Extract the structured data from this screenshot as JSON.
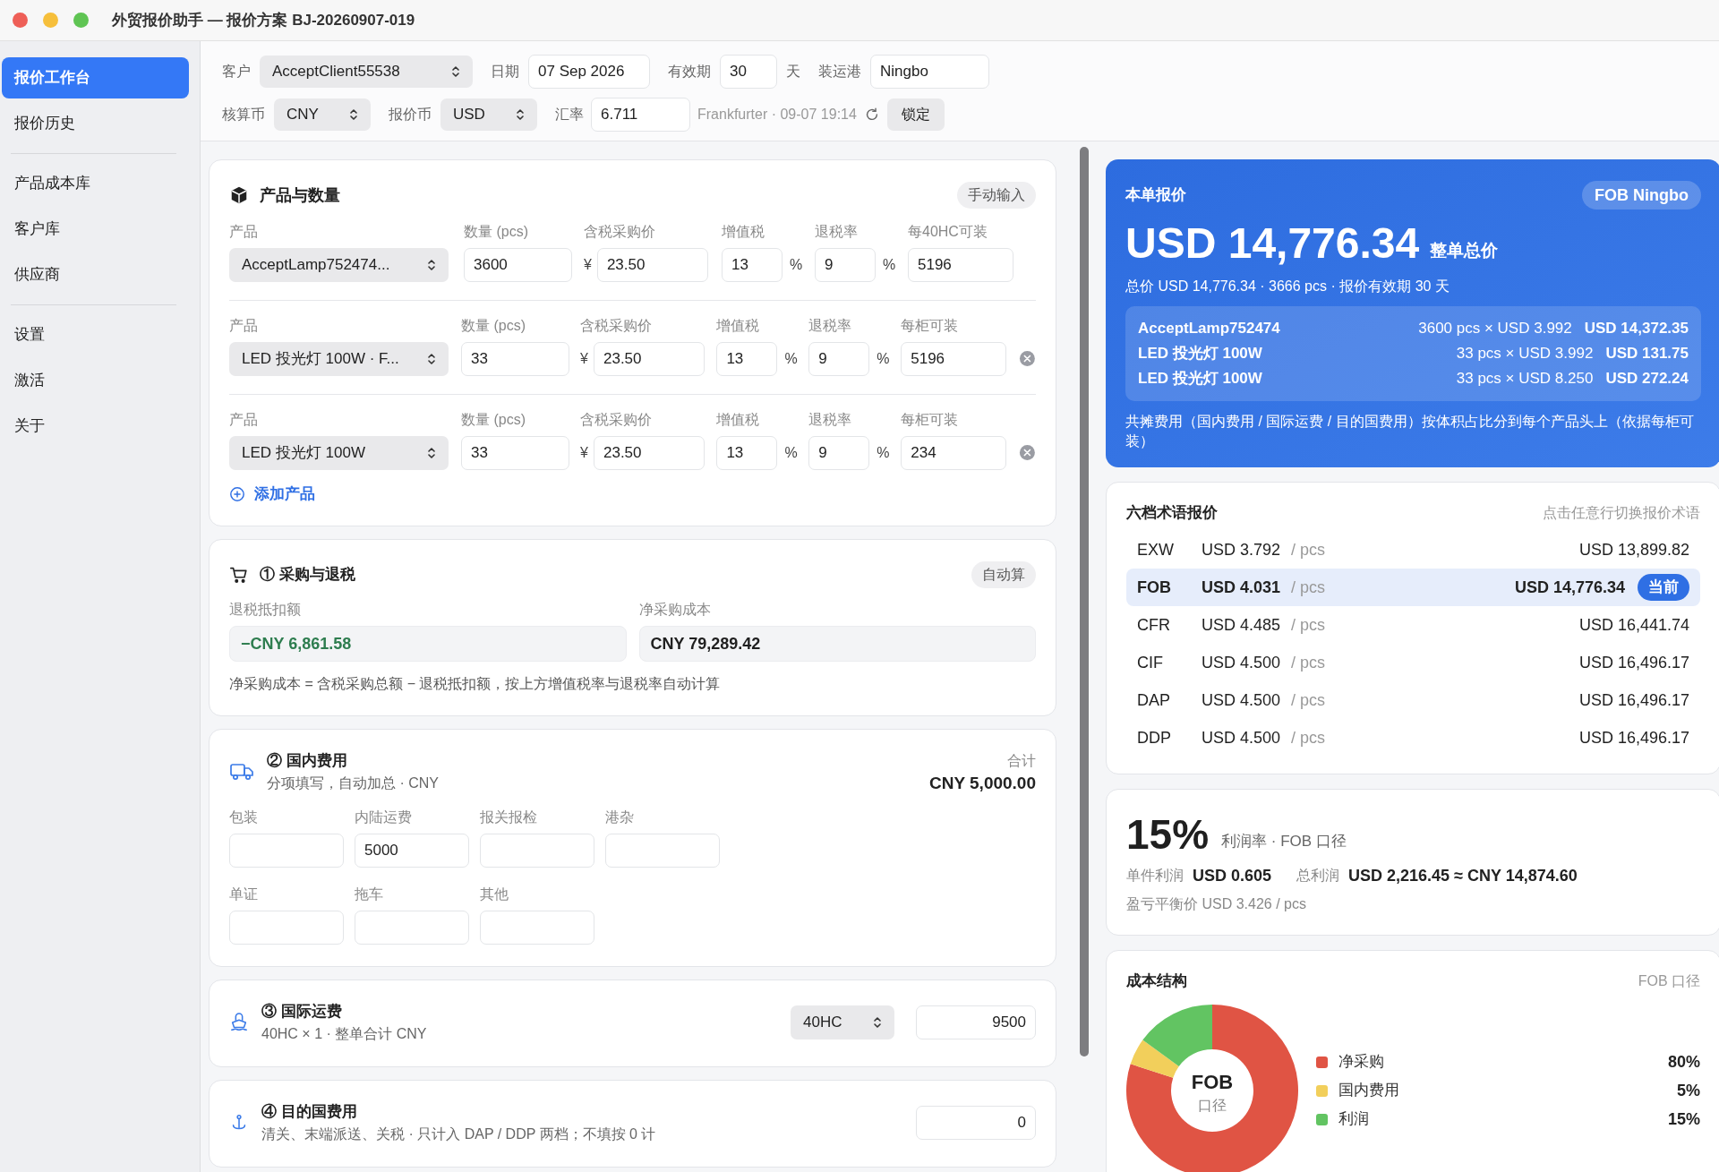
{
  "window": {
    "title": "外贸报价助手 — 报价方案 BJ-20260907-019"
  },
  "sidebar": {
    "groups": [
      {
        "items": [
          {
            "label": "报价工作台",
            "selected": true
          },
          {
            "label": "报价历史",
            "selected": false
          }
        ]
      },
      {
        "items": [
          {
            "label": "产品成本库",
            "selected": false
          },
          {
            "label": "客户库",
            "selected": false
          },
          {
            "label": "供应商",
            "selected": false
          }
        ]
      },
      {
        "items": [
          {
            "label": "设置",
            "selected": false
          },
          {
            "label": "激活",
            "selected": false
          },
          {
            "label": "关于",
            "selected": false
          }
        ]
      }
    ]
  },
  "toolbar": {
    "client": {
      "label": "客户",
      "value": "AcceptClient55538"
    },
    "date": {
      "label": "日期",
      "value": "07 Sep 2026"
    },
    "validity": {
      "label": "有效期",
      "value": "30",
      "unit": "天"
    },
    "port": {
      "label": "装运港",
      "value": "Ningbo"
    },
    "cost_currency": {
      "label": "核算币",
      "value": "CNY"
    },
    "quote_currency": {
      "label": "报价币",
      "value": "USD"
    },
    "rate": {
      "label": "汇率",
      "value": "6.711",
      "source": "Frankfurter · 09-07 19:14"
    },
    "lock_button": "锁定"
  },
  "products": {
    "title": "产品与数量",
    "badge": "手动输入",
    "add_button": "添加产品",
    "rows": [
      {
        "labels": [
          "产品",
          "数量 (pcs)",
          "含税采购价",
          "增值税",
          "退税率",
          "每40HC可装"
        ],
        "product": "AcceptLamp752474...",
        "qty": "3600",
        "currency": "¥",
        "price": "23.50",
        "vat": "13",
        "vat_unit": "%",
        "refund": "9",
        "refund_unit": "%",
        "capacity": "5196",
        "removable": false
      },
      {
        "labels": [
          "产品",
          "数量 (pcs)",
          "含税采购价",
          "增值税",
          "退税率",
          "每柜可装"
        ],
        "product": "LED 投光灯 100W · F...",
        "qty": "33",
        "currency": "¥",
        "price": "23.50",
        "vat": "13",
        "vat_unit": "%",
        "refund": "9",
        "refund_unit": "%",
        "capacity": "5196",
        "removable": true
      },
      {
        "labels": [
          "产品",
          "数量 (pcs)",
          "含税采购价",
          "增值税",
          "退税率",
          "每柜可装"
        ],
        "product": "LED 投光灯 100W",
        "qty": "33",
        "currency": "¥",
        "price": "23.50",
        "vat": "13",
        "vat_unit": "%",
        "refund": "9",
        "refund_unit": "%",
        "capacity": "234",
        "removable": true
      }
    ]
  },
  "purchase": {
    "title": "① 采购与退税",
    "badge": "自动算",
    "fields": [
      {
        "label": "退税抵扣额",
        "value": "−CNY 6,861.58",
        "color": "#2e7d4f"
      },
      {
        "label": "净采购成本",
        "value": "CNY 79,289.42",
        "color": "#1f1f1f"
      }
    ],
    "note": "净采购成本 = 含税采购总额 − 退税抵扣额，按上方增值税率与退税率自动计算"
  },
  "domestic": {
    "title": "② 国内费用",
    "subtitle": "分项填写，自动加总 · CNY",
    "total_label": "合计",
    "total": "CNY 5,000.00",
    "fields": [
      {
        "label": "包装"
      },
      {
        "label": "内陆运费",
        "value": "5000"
      },
      {
        "label": "报关报检"
      },
      {
        "label": "港杂"
      },
      {
        "label": "单证"
      },
      {
        "label": "拖车"
      },
      {
        "label": "其他"
      }
    ]
  },
  "freight": {
    "title": "③ 国际运费",
    "subtitle": "40HC × 1 · 整单合计 CNY",
    "container": "40HC",
    "value": "9500"
  },
  "destination": {
    "title": "④ 目的国费用",
    "subtitle": "清关、末端派送、关税 · 只计入 DAP / DDP 两档；不填按 0 计",
    "value": "0"
  },
  "quote": {
    "label": "本单报价",
    "badge": "FOB Ningbo",
    "amount": "USD 14,776.34",
    "amount_suffix": "整单总价",
    "summary": "总价 USD 14,776.34 · 3666 pcs · 报价有效期 30 天",
    "lines": [
      {
        "name": "AcceptLamp752474",
        "calc": "3600 pcs × USD 3.992",
        "total": "USD 14,372.35"
      },
      {
        "name": "LED 投光灯 100W",
        "calc": "33 pcs × USD 3.992",
        "total": "USD 131.75"
      },
      {
        "name": "LED 投光灯 100W",
        "calc": "33 pcs × USD 8.250",
        "total": "USD 272.24"
      }
    ],
    "note": "共摊费用（国内费用 / 国际运费 / 目的国费用）按体积占比分到每个产品头上（依据每柜可装）"
  },
  "terms": {
    "title": "六档术语报价",
    "hint": "点击任意行切换报价术语",
    "current_badge": "当前",
    "rows": [
      {
        "term": "EXW",
        "unit_price": "USD 3.792",
        "unit": "/ pcs",
        "total": "USD 13,899.82",
        "selected": false
      },
      {
        "term": "FOB",
        "unit_price": "USD 4.031",
        "unit": "/ pcs",
        "total": "USD 14,776.34",
        "selected": true
      },
      {
        "term": "CFR",
        "unit_price": "USD 4.485",
        "unit": "/ pcs",
        "total": "USD 16,441.74",
        "selected": false
      },
      {
        "term": "CIF",
        "unit_price": "USD 4.500",
        "unit": "/ pcs",
        "total": "USD 16,496.17",
        "selected": false
      },
      {
        "term": "DAP",
        "unit_price": "USD 4.500",
        "unit": "/ pcs",
        "total": "USD 16,496.17",
        "selected": false
      },
      {
        "term": "DDP",
        "unit_price": "USD 4.500",
        "unit": "/ pcs",
        "total": "USD 16,496.17",
        "selected": false
      }
    ]
  },
  "profit": {
    "rate": "15%",
    "rate_label": "利润率 · FOB 口径",
    "items": [
      {
        "label": "单件利润",
        "value": "USD 0.605"
      },
      {
        "label": "总利润",
        "value": "USD 2,216.45 ≈ CNY 14,874.60"
      }
    ],
    "breakeven": "盈亏平衡价 USD 3.426 / pcs"
  },
  "cost": {
    "title": "成本结构",
    "hint": "FOB 口径",
    "center_title": "FOB",
    "center_subtitle": "口径",
    "chart_data": {
      "type": "donut",
      "categories": [
        "净采购",
        "国内费用",
        "利润"
      ],
      "values": [
        80,
        5,
        15
      ]
    },
    "legend": [
      {
        "value": "80%",
        "color": "#e05444"
      },
      {
        "value": "5%",
        "color": "#f2cf5b"
      },
      {
        "value": "15%",
        "color": "#62c462"
      }
    ]
  }
}
